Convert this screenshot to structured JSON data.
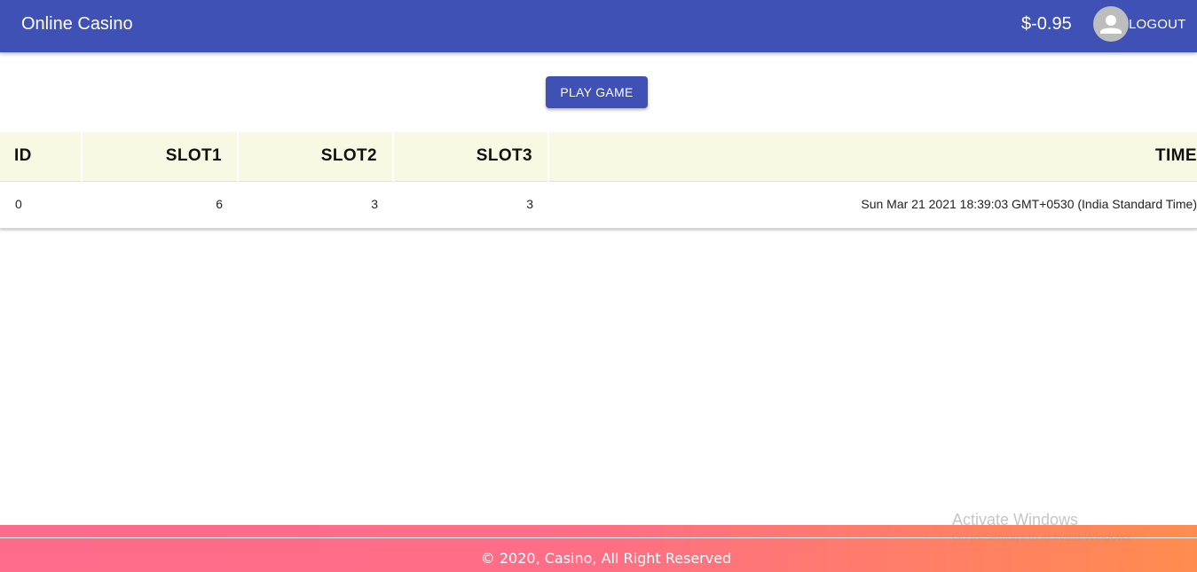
{
  "appbar": {
    "title": "Online Casino",
    "balance": "$-0.95",
    "logout_label": "LOGOUT",
    "color": "#3f51b5"
  },
  "play_button": {
    "label": "PLAY GAME"
  },
  "table": {
    "headers": [
      "ID",
      "SLOT1",
      "SLOT2",
      "SLOT3",
      "TIME"
    ],
    "header_background": "#f8f9e3",
    "rows": [
      {
        "id": "0",
        "slot1": "6",
        "slot2": "3",
        "slot3": "3",
        "time": "Sun Mar 21 2021 18:39:03 GMT+0530 (India Standard Time)"
      }
    ]
  },
  "watermark": {
    "title": "Activate Windows",
    "subtitle": "Go to Settings to activate Windows."
  },
  "footer": {
    "text": "© 2020, Casino, All Right Reserved"
  }
}
